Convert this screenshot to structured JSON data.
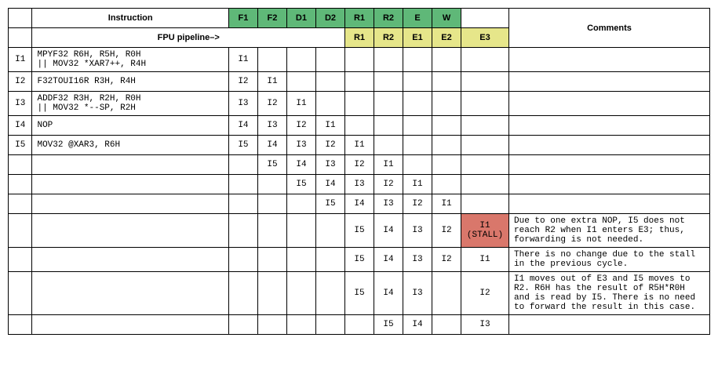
{
  "headers": {
    "instruction": "Instruction",
    "fpu_pipeline": "FPU pipeline–>",
    "comments": "Comments",
    "row1": {
      "f1": "F1",
      "f2": "F2",
      "d1": "D1",
      "d2": "D2",
      "r1": "R1",
      "r2": "R2",
      "e": "E",
      "w": "W"
    },
    "row2": {
      "r1": "R1",
      "r2": "R2",
      "e1": "E1",
      "e2": "E2",
      "e3": "E3"
    }
  },
  "ids": {
    "i1": "I1",
    "i2": "I2",
    "i3": "I3",
    "i4": "I4",
    "i5": "I5"
  },
  "inst": {
    "i1a": "MPYF32 R6H, R5H, R0H",
    "i1b": "|| MOV32 *XAR7++, R4H",
    "i2": "F32TOUI16R R3H, R4H",
    "i3a": "ADDF32 R3H, R2H, R0H",
    "i3b": "|| MOV32 *--SP, R2H",
    "i4": "NOP",
    "i5": "MOV32 @XAR3, R6H"
  },
  "stall": {
    "l1": "I1",
    "l2": "(STALL)"
  },
  "comments": {
    "c1": "Due to one extra NOP, I5 does not reach R2 when I1 enters E3; thus, forwarding is not needed.",
    "c2": "There is no change due to the stall in the previous cycle.",
    "c3": "I1 moves out of E3 and I5 moves to R2. R6H has the result of R5H*R0H and is read by I5. There is no need to forward the result in this case."
  },
  "chart_data": {
    "type": "table",
    "title": "FPU pipeline diagram",
    "main_stages": [
      "F1",
      "F2",
      "D1",
      "D2",
      "R1",
      "R2",
      "E",
      "W"
    ],
    "fpu_sub_stages": {
      "R1": "R1",
      "R2": "R2",
      "E": "E1",
      "W": "E2",
      "extra": "E3"
    },
    "instructions": [
      {
        "id": "I1",
        "text": "MPYF32 R6H, R5H, R0H || MOV32 *XAR7++, R4H"
      },
      {
        "id": "I2",
        "text": "F32TOUI16R R3H, R4H"
      },
      {
        "id": "I3",
        "text": "ADDF32 R3H, R2H, R0H || MOV32 *--SP, R2H"
      },
      {
        "id": "I4",
        "text": "NOP"
      },
      {
        "id": "I5",
        "text": "MOV32 @XAR3, R6H"
      }
    ],
    "cycles": [
      {
        "F1": "I1"
      },
      {
        "F1": "I2",
        "F2": "I1"
      },
      {
        "F1": "I3",
        "F2": "I2",
        "D1": "I1"
      },
      {
        "F1": "I4",
        "F2": "I3",
        "D1": "I2",
        "D2": "I1"
      },
      {
        "F1": "I5",
        "F2": "I4",
        "D1": "I3",
        "D2": "I2",
        "R1": "I1"
      },
      {
        "F2": "I5",
        "D1": "I4",
        "D2": "I3",
        "R1": "I2",
        "R2": "I1"
      },
      {
        "D1": "I5",
        "D2": "I4",
        "R1": "I3",
        "R2": "I2",
        "E": "I1"
      },
      {
        "D2": "I5",
        "R1": "I4",
        "R2": "I3",
        "E": "I2",
        "W": "I1"
      },
      {
        "R1": "I5",
        "R2": "I4",
        "E": "I3",
        "W": "I2",
        "E3": "I1 (STALL)",
        "comment": "Due to one extra NOP, I5 does not reach R2 when I1 enters E3; thus, forwarding is not needed."
      },
      {
        "R1": "I5",
        "R2": "I4",
        "E": "I3",
        "W": "I2",
        "E3": "I1",
        "comment": "There is no change due to the stall in the previous cycle."
      },
      {
        "R1": "I5",
        "R2": "I4",
        "E": "I3",
        "W": "I2",
        "comment": "I1 moves out of E3 and I5 moves to R2. R6H has the result of R5H*R0H and is read by I5. There is no need to forward the result in this case."
      },
      {
        "R2": "I5",
        "E": "I4",
        "W": "I3"
      }
    ]
  }
}
